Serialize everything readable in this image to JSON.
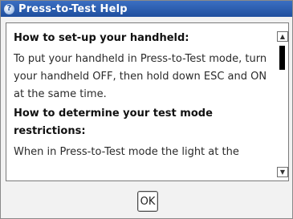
{
  "window": {
    "title": "Press-to-Test Help",
    "icon": "help-icon"
  },
  "content": {
    "heading1": "How to set-up your handheld:",
    "paragraph1": "To put your handheld in Press-to-Test mode, turn your handheld OFF, then hold down ESC and ON at the same time.",
    "heading2": "How to determine your test mode restrictions:",
    "paragraph2": "When in Press-to-Test mode the light at the"
  },
  "scrollbar": {
    "up_arrow": "▲",
    "down_arrow": "▼"
  },
  "buttons": {
    "ok_label": "OK"
  }
}
